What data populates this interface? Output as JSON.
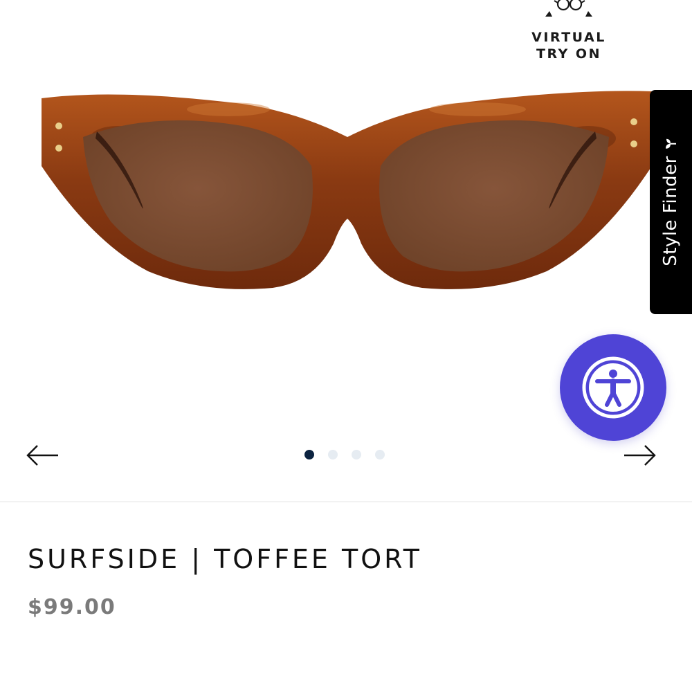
{
  "virtual_try_on": {
    "line1": "VIRTUAL",
    "line2": "TRY ON",
    "icon": "glasses-icon"
  },
  "product": {
    "title": "SURFSIDE | TOFFEE TORT",
    "price": "$99.00",
    "image": {
      "description_icon": "sunglasses-image",
      "frame_color": "#8a3a12",
      "lens_color": "#7a4a2e"
    }
  },
  "style_finder": {
    "label": "Style Finder",
    "icon": "sprout-icon",
    "background": "#000000"
  },
  "accessibility": {
    "icon": "accessibility-icon",
    "color": "#4f44d6"
  },
  "carousel": {
    "prev_icon": "arrow-left-icon",
    "next_icon": "arrow-right-icon",
    "slide_count": 4,
    "active_index": 0,
    "active_color": "#0c2340",
    "inactive_color": "#e6ecf2"
  }
}
